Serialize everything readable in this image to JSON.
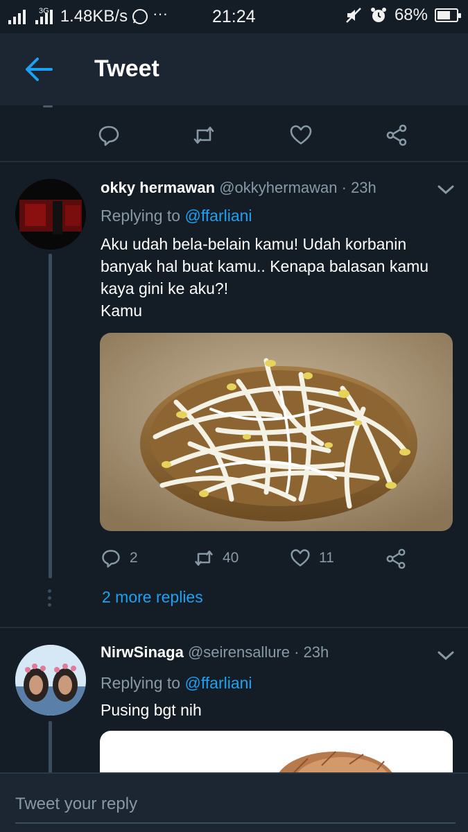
{
  "status_bar": {
    "network_speed": "1.48KB/s",
    "net_type": "3G",
    "time": "21:24",
    "battery": "68%",
    "battery_level": 0.68
  },
  "header": {
    "title": "Tweet"
  },
  "tweets": [
    {
      "name": "okky hermawan",
      "handle": "@okkyhermawan",
      "age": "· 23h",
      "replying_prefix": "Replying to",
      "replying_to": "@ffarliani",
      "lines": [
        "Aku udah bela-belain kamu! Udah korbanin",
        "banyak hal buat kamu.. Kenapa balasan kamu",
        "kaya gini ke aku?!",
        "Kamu"
      ],
      "replies": "2",
      "retweets": "40",
      "likes": "11",
      "more_replies": "2 more replies"
    },
    {
      "name": "NirwSinaga",
      "handle": "@seirensallure",
      "age": "· 23h",
      "replying_prefix": "Replying to",
      "replying_to": "@ffarliani",
      "lines": [
        "Pusing bgt nih"
      ]
    }
  ],
  "composer": {
    "placeholder": "Tweet your reply"
  },
  "colors": {
    "background": "#141d26",
    "header": "#1b2632",
    "accent": "#1da1f2",
    "muted": "#8899a6"
  },
  "icons": [
    "back-arrow-icon",
    "reply-icon",
    "retweet-icon",
    "like-icon",
    "share-icon",
    "chevron-down-icon"
  ]
}
